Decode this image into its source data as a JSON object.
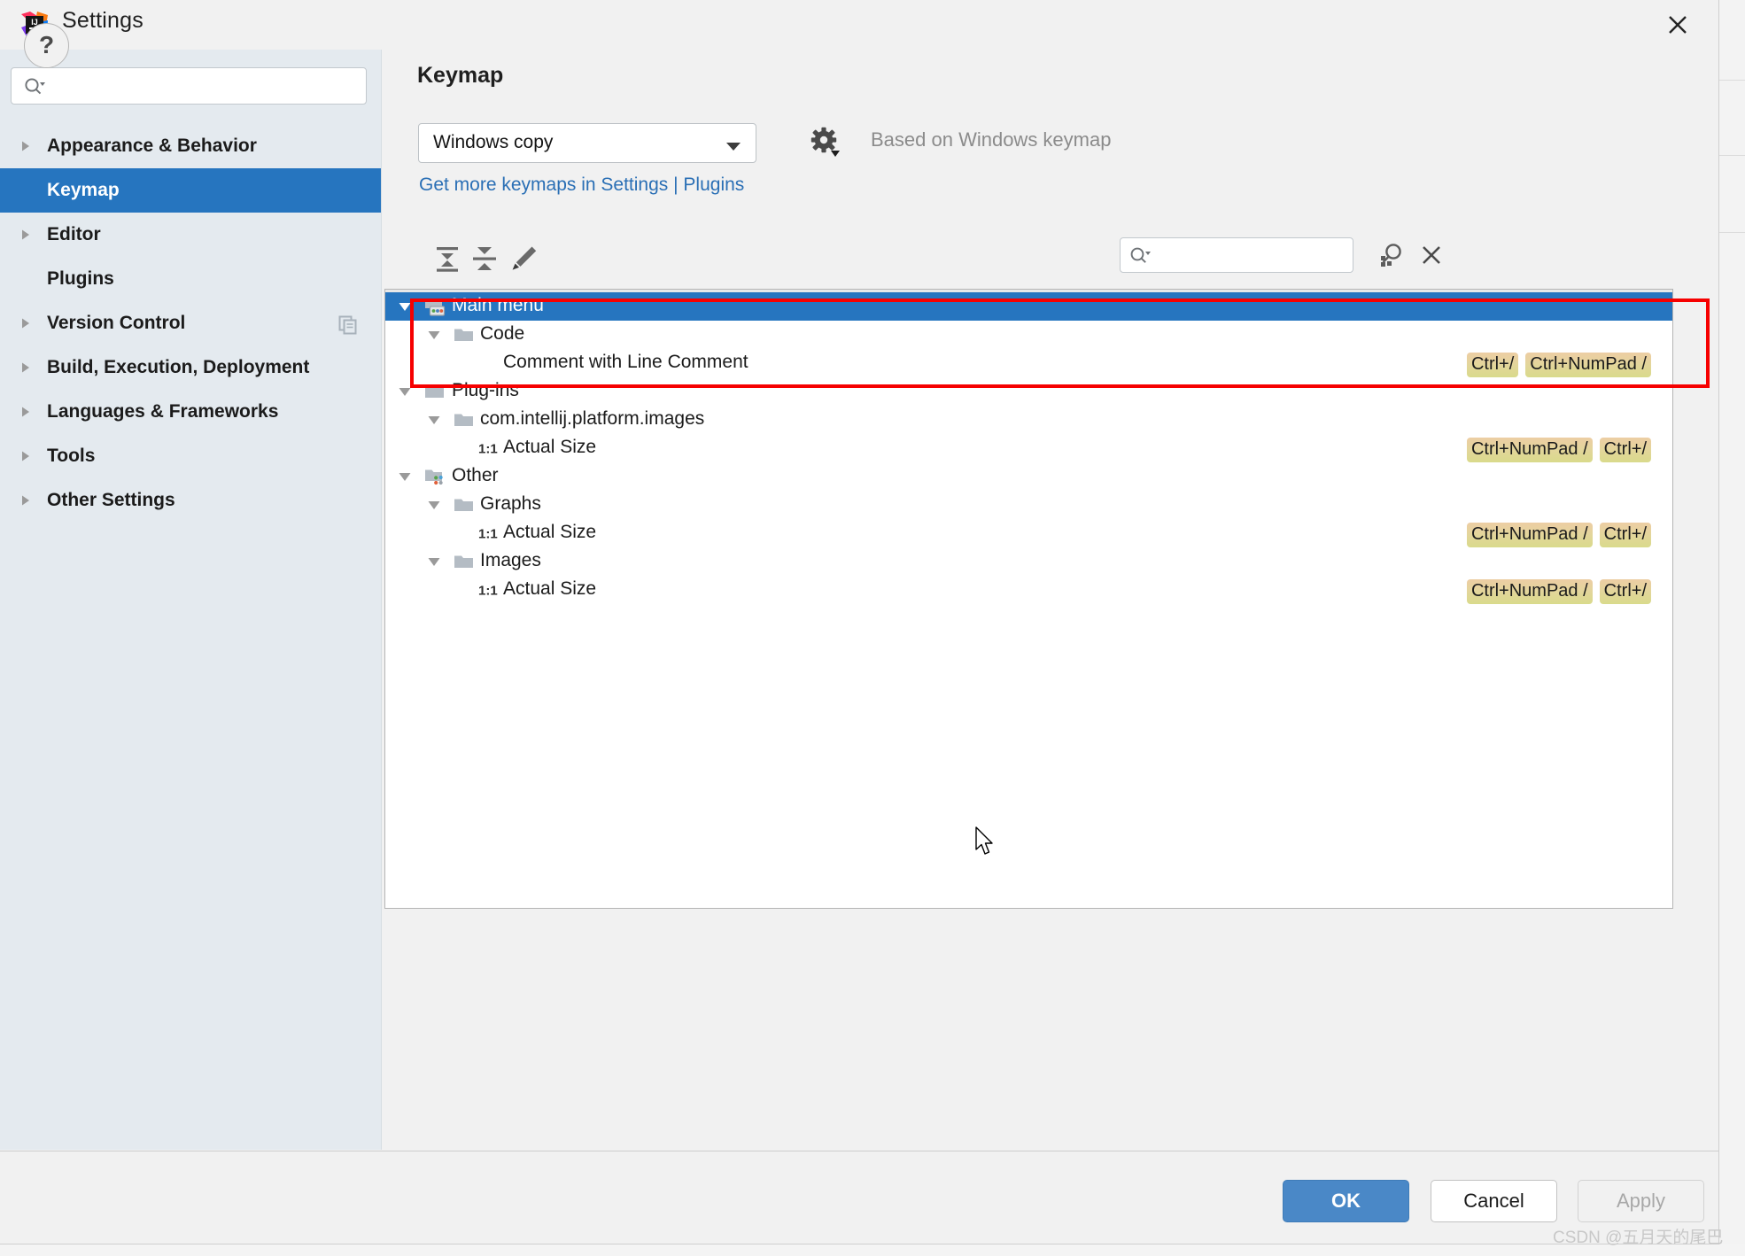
{
  "window": {
    "title": "Settings",
    "logo_icon": "intellij-idea-logo",
    "close_icon": "close-icon"
  },
  "sidebar": {
    "search": {
      "value": "",
      "placeholder": "",
      "icon": "search-dropdown-icon"
    },
    "items": [
      {
        "label": "Appearance & Behavior",
        "expandable": true,
        "selected": false,
        "extra_icon": ""
      },
      {
        "label": "Keymap",
        "expandable": false,
        "selected": true,
        "extra_icon": ""
      },
      {
        "label": "Editor",
        "expandable": true,
        "selected": false,
        "extra_icon": ""
      },
      {
        "label": "Plugins",
        "expandable": false,
        "selected": false,
        "extra_icon": ""
      },
      {
        "label": "Version Control",
        "expandable": true,
        "selected": false,
        "extra_icon": "copy-icon"
      },
      {
        "label": "Build, Execution, Deployment",
        "expandable": true,
        "selected": false,
        "extra_icon": ""
      },
      {
        "label": "Languages & Frameworks",
        "expandable": true,
        "selected": false,
        "extra_icon": ""
      },
      {
        "label": "Tools",
        "expandable": true,
        "selected": false,
        "extra_icon": ""
      },
      {
        "label": "Other Settings",
        "expandable": true,
        "selected": false,
        "extra_icon": ""
      }
    ]
  },
  "main": {
    "page_title": "Keymap",
    "keymap_select": {
      "value": "Windows copy",
      "icon": "chevron-down-icon"
    },
    "gear_icon": "gear-dropdown-icon",
    "based_on": "Based on Windows keymap",
    "more_keymaps_link": "Get more keymaps in Settings | Plugins",
    "toolbar": {
      "expand_all_icon": "expand-all-icon",
      "collapse_all_icon": "collapse-all-icon",
      "edit_icon": "pencil-edit-icon",
      "search": {
        "value": "",
        "placeholder": "",
        "icon": "search-dropdown-icon"
      },
      "find_by_shortcut_icon": "find-by-shortcut-icon",
      "clear_icon": "close-icon"
    }
  },
  "tree": [
    {
      "label": "Main menu",
      "depth": 0,
      "arrow": "down",
      "icon": "menu-folder-icon",
      "selected": true,
      "shortcuts": []
    },
    {
      "label": "Code",
      "depth": 1,
      "arrow": "down",
      "icon": "folder-icon",
      "selected": false,
      "shortcuts": []
    },
    {
      "label": "Comment with Line Comment",
      "depth": 2,
      "arrow": "none",
      "icon": "none",
      "selected": false,
      "shortcuts": [
        "Ctrl+/",
        "Ctrl+NumPad /"
      ]
    },
    {
      "label": "Plug-ins",
      "depth": 0,
      "arrow": "down",
      "icon": "folder-icon",
      "selected": false,
      "shortcuts": []
    },
    {
      "label": "com.intellij.platform.images",
      "depth": 1,
      "arrow": "down",
      "icon": "folder-icon",
      "selected": false,
      "shortcuts": []
    },
    {
      "label": "Actual Size",
      "depth": 2,
      "arrow": "none",
      "icon": "actual-size-icon",
      "selected": false,
      "shortcuts": [
        "Ctrl+NumPad /",
        "Ctrl+/"
      ]
    },
    {
      "label": "Other",
      "depth": 0,
      "arrow": "down",
      "icon": "other-folder-icon",
      "selected": false,
      "shortcuts": []
    },
    {
      "label": "Graphs",
      "depth": 1,
      "arrow": "down",
      "icon": "folder-icon",
      "selected": false,
      "shortcuts": []
    },
    {
      "label": "Actual Size",
      "depth": 2,
      "arrow": "none",
      "icon": "actual-size-icon",
      "selected": false,
      "shortcuts": [
        "Ctrl+NumPad /",
        "Ctrl+/"
      ]
    },
    {
      "label": "Images",
      "depth": 1,
      "arrow": "down",
      "icon": "folder-icon",
      "selected": false,
      "shortcuts": []
    },
    {
      "label": "Actual Size",
      "depth": 2,
      "arrow": "none",
      "icon": "actual-size-icon",
      "selected": false,
      "shortcuts": [
        "Ctrl+NumPad /",
        "Ctrl+/"
      ]
    }
  ],
  "footer": {
    "help_label": "?",
    "ok_label": "OK",
    "cancel_label": "Cancel",
    "apply_label": "Apply"
  },
  "annotation": {
    "color": "#f60000"
  },
  "watermark": "CSDN @五月天的尾巴",
  "colors": {
    "selection_blue": "#2675bf",
    "sidebar_bg": "#e4eaef",
    "panel_bg": "#f1f1f1",
    "link_blue": "#2a6fb5",
    "ok_blue": "#4a88c7"
  }
}
